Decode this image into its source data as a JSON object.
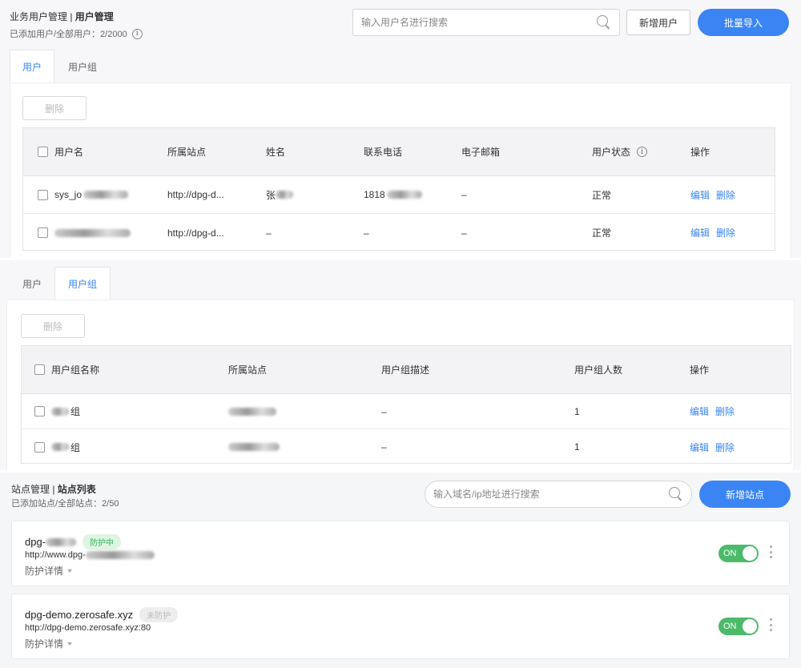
{
  "users": {
    "breadcrumb_prefix": "业务用户管理 | ",
    "breadcrumb_current": "用户管理",
    "summary": "已添加用户/全部用户：2/2000",
    "search_placeholder": "输入用户名进行搜索",
    "new_user_label": "新增用户",
    "import_label": "批量导入",
    "tabs": [
      "用户",
      "用户组"
    ],
    "delete_label": "删除",
    "columns": [
      "用户名",
      "所属站点",
      "姓名",
      "联系电话",
      "电子邮箱",
      "用户状态",
      "操作"
    ],
    "rows": [
      {
        "username": "sys_jo",
        "site": "http://dpg-d...",
        "name": "张",
        "phone": "1818",
        "email": "–",
        "status": "正常"
      },
      {
        "username": "",
        "site": "http://dpg-d...",
        "name": "–",
        "phone": "–",
        "email": "–",
        "status": "正常"
      }
    ],
    "edit_label": "编辑",
    "remove_label": "删除"
  },
  "groups": {
    "tabs": [
      "用户",
      "用户组"
    ],
    "delete_label": "删除",
    "columns": [
      "用户组名称",
      "所属站点",
      "用户组描述",
      "用户组人数",
      "操作"
    ],
    "rows": [
      {
        "name": "组",
        "desc": "–",
        "count": "1"
      },
      {
        "name": "组",
        "desc": "–",
        "count": "1"
      }
    ],
    "edit_label": "编辑",
    "remove_label": "删除"
  },
  "sites": {
    "breadcrumb_prefix": "站点管理 | ",
    "breadcrumb_current": "站点列表",
    "summary": "已添加站点/全部站点：2/50",
    "search_placeholder": "输入域名/ip地址进行搜索",
    "new_site_label": "新增站点",
    "cards": [
      {
        "name": "dpg-",
        "badge": "防护中",
        "url": "http://www.dpg-",
        "detail": "防护详情",
        "toggle": "ON"
      },
      {
        "name": "dpg-demo.zerosafe.xyz",
        "badge": "未防护",
        "url": "http://dpg-demo.zerosafe.xyz:80",
        "detail": "防护详情",
        "toggle": "ON"
      }
    ]
  },
  "colors": {
    "primary": "#3a85f3",
    "success": "#4cba6b"
  }
}
